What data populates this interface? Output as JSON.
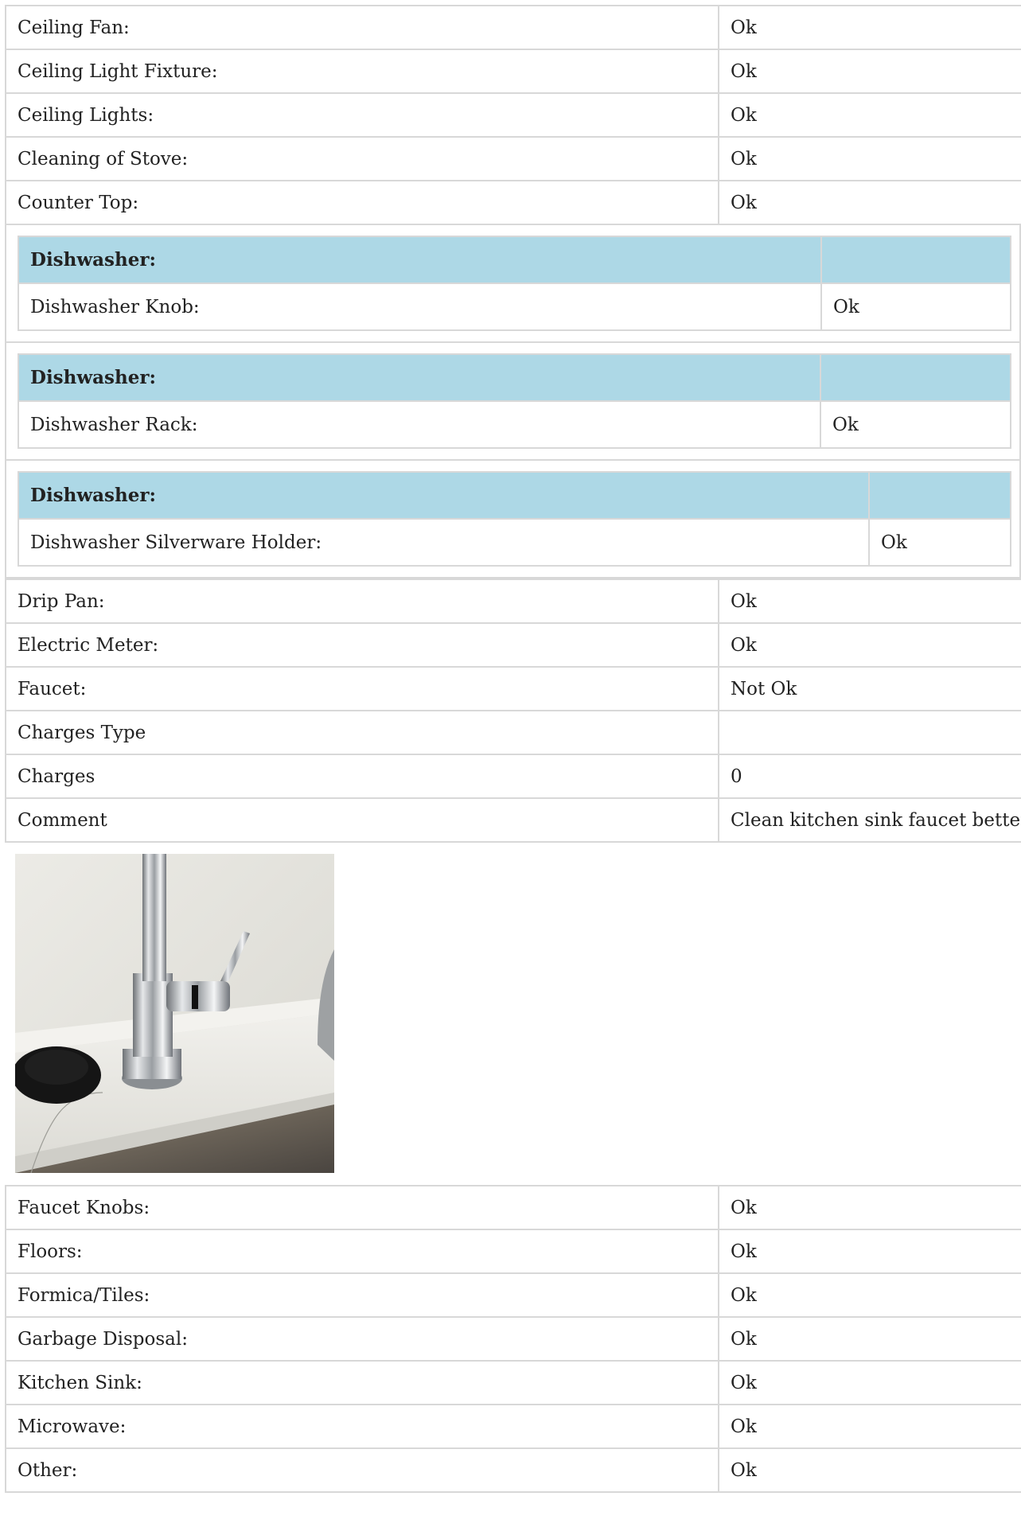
{
  "rows_top": [
    {
      "label": "Ceiling Fan:",
      "value": "Ok"
    },
    {
      "label": "Ceiling Light Fixture:",
      "value": "Ok"
    },
    {
      "label": "Ceiling Lights:",
      "value": "Ok"
    },
    {
      "label": "Cleaning of Stove:",
      "value": "Ok"
    },
    {
      "label": "Counter Top:",
      "value": "Ok"
    }
  ],
  "dishwasher_groups": [
    {
      "heading": "Dishwasher:",
      "label": "Dishwasher Knob:",
      "value": "Ok"
    },
    {
      "heading": "Dishwasher:",
      "label": "Dishwasher Rack:",
      "value": "Ok"
    },
    {
      "heading": "Dishwasher:",
      "label": "Dishwasher Silverware Holder:",
      "value": "Ok"
    }
  ],
  "rows_mid": [
    {
      "label": "Drip Pan:",
      "value": "Ok"
    },
    {
      "label": "Electric Meter:",
      "value": "Ok"
    },
    {
      "label": "Faucet:",
      "value": "Not Ok"
    },
    {
      "label": "Charges Type",
      "value": ""
    },
    {
      "label": "Charges",
      "value": "0"
    },
    {
      "label": "Comment",
      "value": "Clean kitchen sink faucet better"
    }
  ],
  "photo": {
    "subject": "faucet-photo"
  },
  "rows_bottom": [
    {
      "label": "Faucet Knobs:",
      "value": "Ok"
    },
    {
      "label": "Floors:",
      "value": "Ok"
    },
    {
      "label": "Formica/Tiles:",
      "value": "Ok"
    },
    {
      "label": "Garbage Disposal:",
      "value": "Ok"
    },
    {
      "label": "Kitchen Sink:",
      "value": "Ok"
    },
    {
      "label": "Microwave:",
      "value": "Ok"
    },
    {
      "label": "Other:",
      "value": "Ok"
    }
  ],
  "colors": {
    "heading_bg": "#add8e6",
    "border": "#d8d8d8",
    "text": "#222222"
  }
}
